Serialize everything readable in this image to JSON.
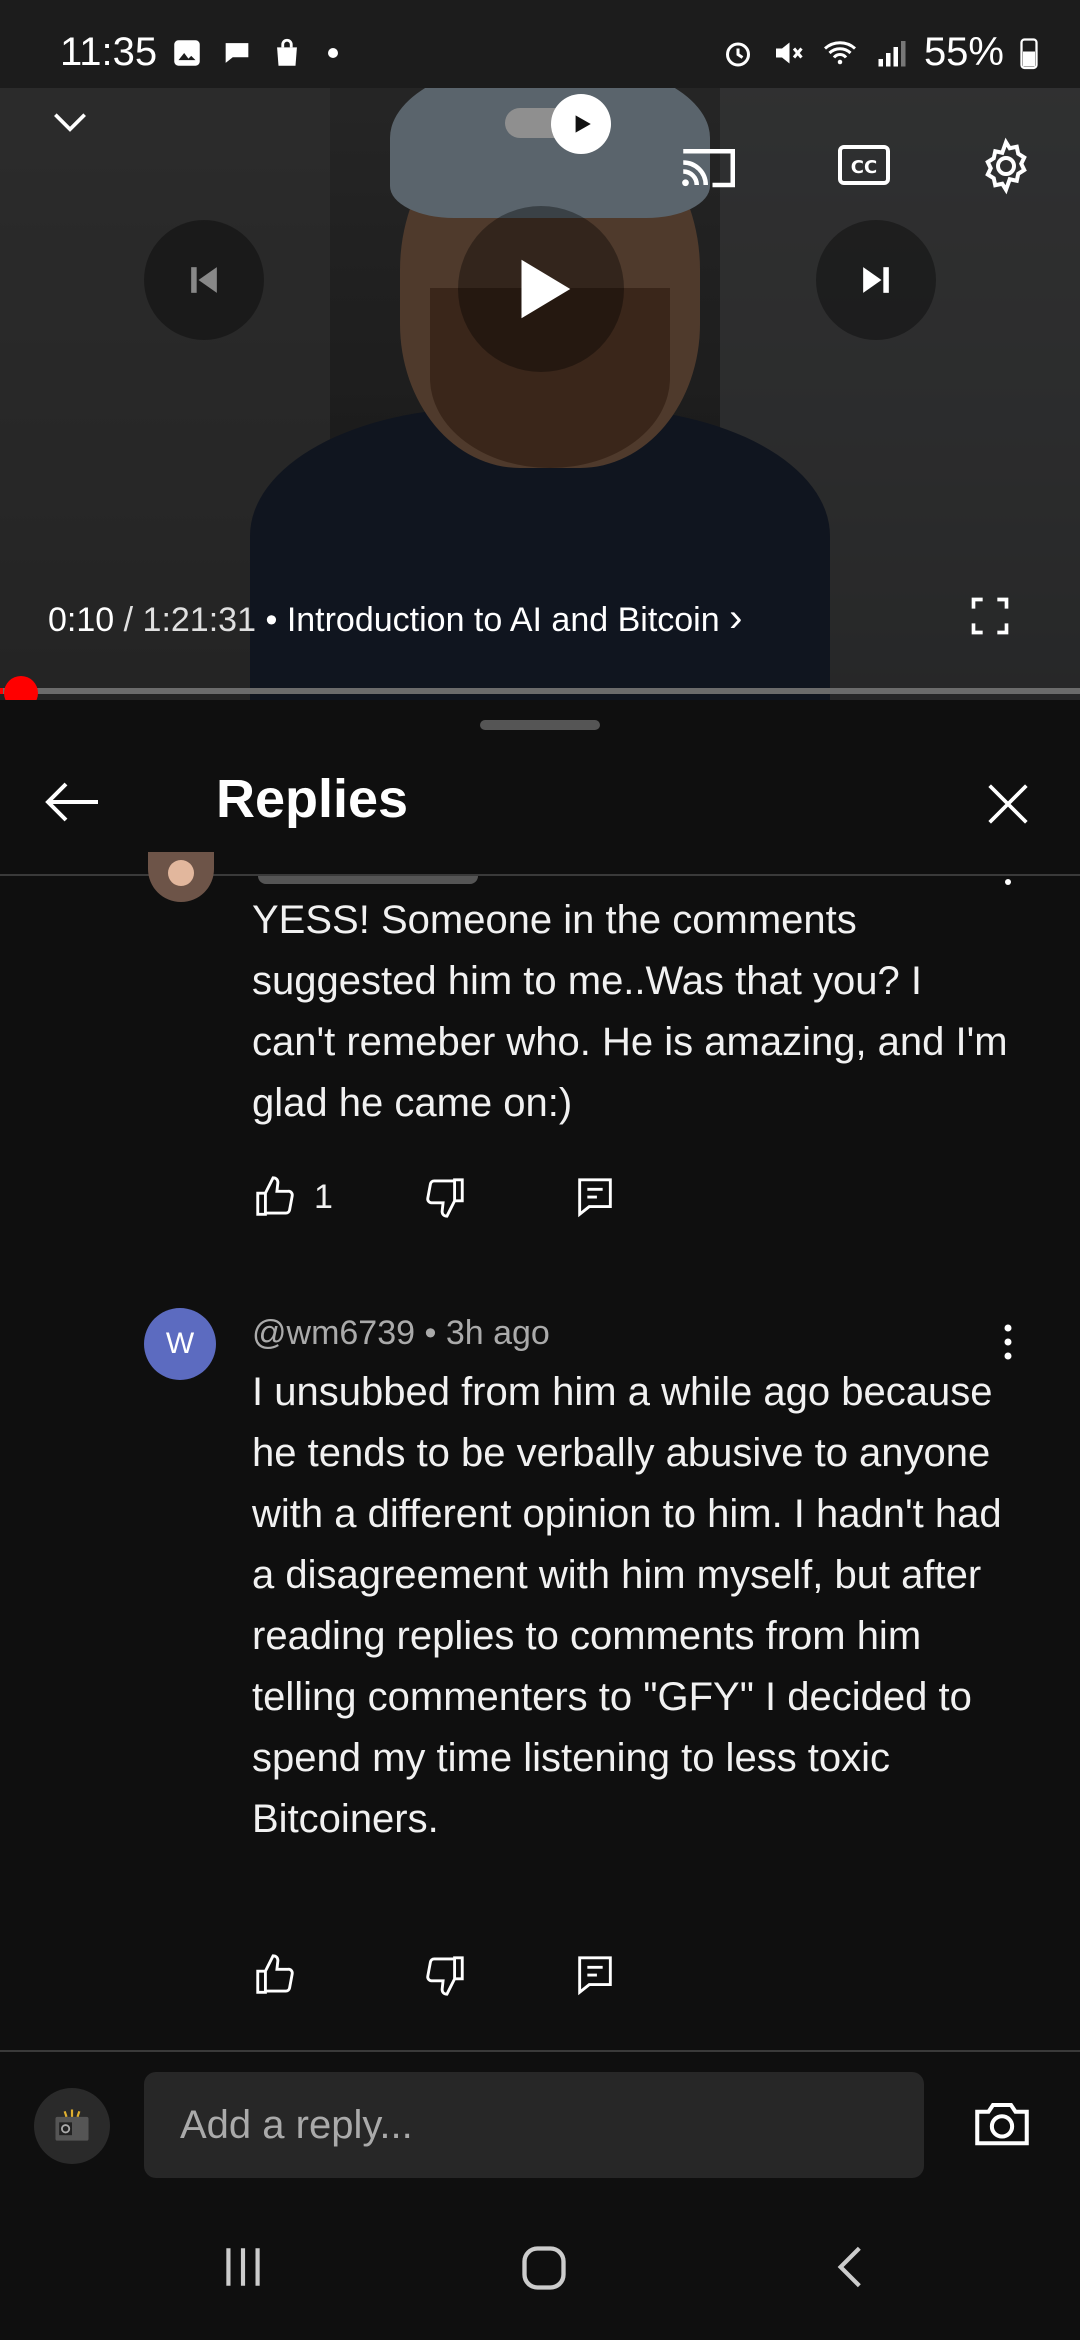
{
  "status_bar": {
    "time": "11:35",
    "battery": "55%"
  },
  "player": {
    "current_time": "0:10",
    "separator": "/",
    "duration": "1:21:31",
    "bullet": "•",
    "chapter": "Introduction to AI and Bitcoin",
    "chapter_arrow": "›",
    "progress_fraction": 0.002
  },
  "panel": {
    "title": "Replies"
  },
  "comments": [
    {
      "text": "YESS! Someone in the comments suggested him to me..Was that you? I can't remeber who. He is amazing, and I'm glad he came on:)",
      "likes": "1"
    },
    {
      "avatar_letter": "W",
      "author": "@wm6739",
      "time_ago": "3h ago",
      "text": "I unsubbed from him a while ago because he tends to be verbally abusive to anyone with a different opinion to him. I hadn't had a disagreement with him myself, but after reading replies to comments from him telling commenters to \"GFY\" I decided to spend my time listening to less toxic Bitcoiners.",
      "likes": ""
    }
  ],
  "reply_box": {
    "placeholder": "Add a reply..."
  },
  "colors": {
    "accent": "#ff0000",
    "avatar_w": "#5c6bc0",
    "background": "#0f0f0f"
  },
  "icons": [
    "collapse-icon",
    "autoplay-toggle-icon",
    "cast-icon",
    "captions-icon",
    "settings-icon",
    "previous-icon",
    "play-icon",
    "next-icon",
    "fullscreen-icon",
    "back-arrow-icon",
    "close-icon",
    "like-icon",
    "dislike-icon",
    "reply-icon",
    "more-vert-icon",
    "camera-icon"
  ]
}
